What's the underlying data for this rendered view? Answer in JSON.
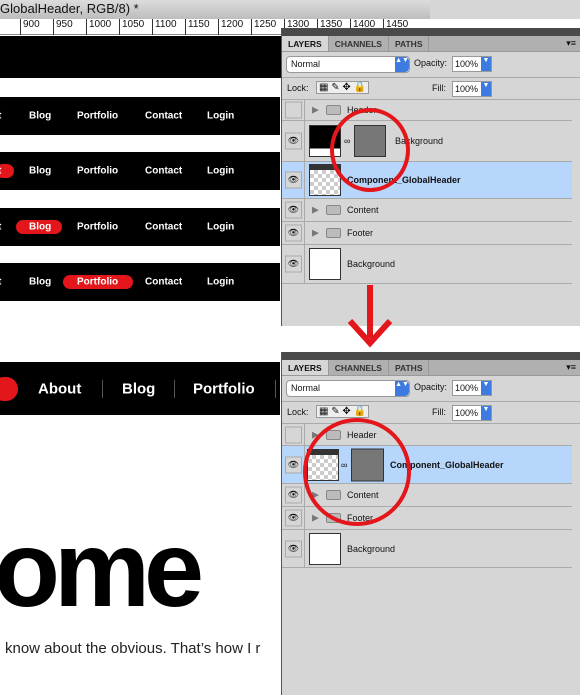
{
  "window": {
    "title": "GlobalHeader, RGB/8) *"
  },
  "ruler": {
    "ticks": [
      "900",
      "950",
      "1000",
      "1050",
      "1100",
      "1150",
      "1200",
      "1250",
      "1300",
      "1350",
      "1400",
      "1450"
    ]
  },
  "top_nav_rows": [
    {
      "items": [
        "t",
        "Blog",
        "Portfolio",
        "Contact",
        "Login"
      ],
      "active": -1
    },
    {
      "items": [
        "t",
        "Blog",
        "Portfolio",
        "Contact",
        "Login"
      ],
      "active": 0
    },
    {
      "items": [
        "t",
        "Blog",
        "Portfolio",
        "Contact",
        "Login"
      ],
      "active": 1
    },
    {
      "items": [
        "t",
        "Blog",
        "Portfolio",
        "Contact",
        "Login"
      ],
      "active": 2
    }
  ],
  "bottom_nav": {
    "items": [
      "About",
      "Blog",
      "Portfolio"
    ]
  },
  "hero": {
    "headline": "ome",
    "body": "know about the obvious. That’s how I r"
  },
  "panel_top": {
    "tabs": [
      "LAYERS",
      "CHANNELS",
      "PATHS"
    ],
    "blend_mode": "Normal",
    "opacity_label": "Opacity:",
    "opacity": "100%",
    "lock_label": "Lock:",
    "fill_label": "Fill:",
    "fill": "100%",
    "layers": [
      {
        "name": "Header",
        "type": "group",
        "visible": false
      },
      {
        "name": "Background",
        "type": "masked",
        "visible": true
      },
      {
        "name": "Component_GlobalHeader",
        "type": "smart",
        "visible": true,
        "selected": true
      },
      {
        "name": "Content",
        "type": "group",
        "visible": true
      },
      {
        "name": "Footer",
        "type": "group",
        "visible": true
      },
      {
        "name": "Background",
        "type": "fill",
        "visible": true
      }
    ]
  },
  "panel_bottom": {
    "tabs": [
      "LAYERS",
      "CHANNELS",
      "PATHS"
    ],
    "blend_mode": "Normal",
    "opacity_label": "Opacity:",
    "opacity": "100%",
    "lock_label": "Lock:",
    "fill_label": "Fill:",
    "fill": "100%",
    "layers": [
      {
        "name": "Header",
        "type": "group",
        "visible": false
      },
      {
        "name": "Component_GlobalHeader",
        "type": "smart-masked",
        "visible": true,
        "selected": true
      },
      {
        "name": "Content",
        "type": "group",
        "visible": true
      },
      {
        "name": "Footer",
        "type": "group",
        "visible": true
      },
      {
        "name": "Background",
        "type": "fill",
        "visible": true
      }
    ]
  },
  "colors": {
    "accent": "#e3161b",
    "selection": "#b7d6fb"
  }
}
